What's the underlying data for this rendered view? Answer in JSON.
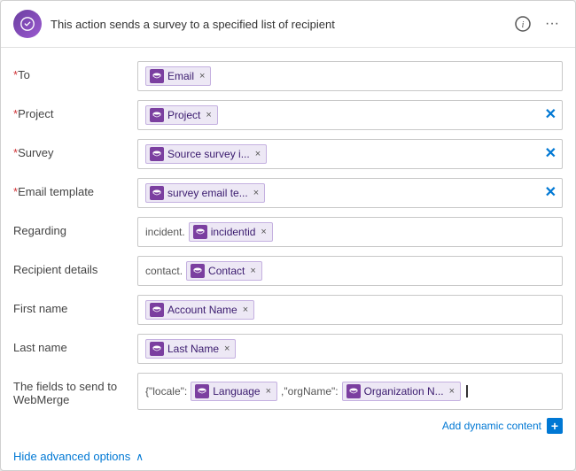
{
  "header": {
    "title": "This action sends a survey to a specified list of recipient",
    "info_icon": "ℹ",
    "more_icon": "···"
  },
  "fields": [
    {
      "id": "to",
      "label": "*To",
      "required": true,
      "tokens": [
        {
          "text": "Email",
          "close": "×"
        }
      ],
      "has_clear": false
    },
    {
      "id": "project",
      "label": "*Project",
      "required": true,
      "tokens": [
        {
          "text": "Project",
          "close": "×"
        }
      ],
      "has_clear": true
    },
    {
      "id": "survey",
      "label": "*Survey",
      "required": true,
      "tokens": [
        {
          "text": "Source survey i...",
          "close": "×"
        }
      ],
      "has_clear": true
    },
    {
      "id": "email-template",
      "label": "*Email template",
      "required": true,
      "tokens": [
        {
          "text": "survey email te...",
          "close": "×"
        }
      ],
      "has_clear": true
    },
    {
      "id": "regarding",
      "label": "Regarding",
      "required": false,
      "prefix_text": "incident.",
      "tokens": [
        {
          "text": "incidentid",
          "close": "×"
        }
      ],
      "has_clear": false
    },
    {
      "id": "recipient-details",
      "label": "Recipient details",
      "required": false,
      "prefix_text": "contact.",
      "tokens": [
        {
          "text": "Contact",
          "close": "×"
        }
      ],
      "has_clear": false
    },
    {
      "id": "first-name",
      "label": "First name",
      "required": false,
      "tokens": [
        {
          "text": "Account Name",
          "close": "×"
        }
      ],
      "has_clear": false
    },
    {
      "id": "last-name",
      "label": "Last name",
      "required": false,
      "tokens": [
        {
          "text": "Last Name",
          "close": "×"
        }
      ],
      "has_clear": false
    },
    {
      "id": "webmerge",
      "label": "The fields to send to WebMerge",
      "required": false,
      "prefix_text": "{\"locale\":",
      "tokens": [
        {
          "text": "Language",
          "close": "×"
        },
        {
          "text": ",\"orgName\":"
        },
        {
          "text": "Organization N...",
          "close": "×"
        }
      ],
      "suffix_text": " »|",
      "has_clear": false
    }
  ],
  "footer": {
    "add_dynamic_label": "Add dynamic content",
    "add_icon": "+"
  },
  "advanced": {
    "label": "Hide advanced options",
    "chevron": "∧"
  }
}
